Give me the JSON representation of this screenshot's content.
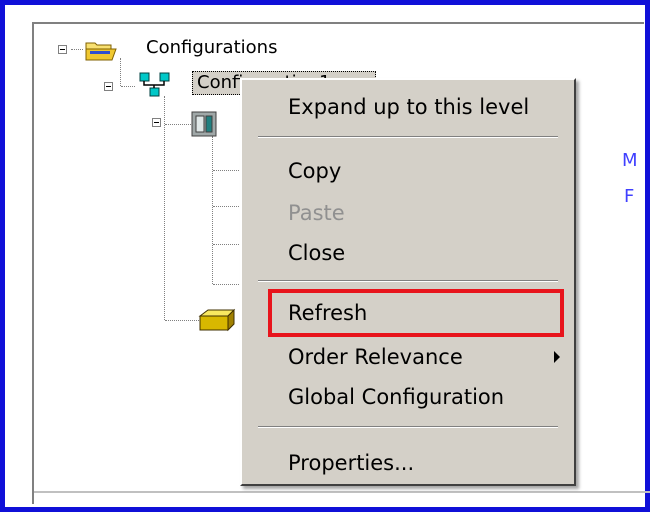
{
  "tree": {
    "root_label": "Configurations",
    "child_label": "Configuration1",
    "peek_right": [
      "M",
      "F"
    ]
  },
  "menu": {
    "expand": "Expand up to this level",
    "copy": "Copy",
    "paste": "Paste",
    "close": "Close",
    "refresh": "Refresh",
    "order_relevance": "Order Relevance",
    "global_configuration": "Global Configuration",
    "properties": "Properties..."
  },
  "colors": {
    "frame_border": "#1010d8",
    "highlight": "#e8141c",
    "menu_bg": "#d4d0c8",
    "link_text": "#4040ff"
  },
  "icons": {
    "root": "open-folder-icon",
    "configuration": "network-nodes-icon",
    "device": "device-icon",
    "module": "module-block-icon",
    "submenu": "submenu-arrow-icon"
  }
}
